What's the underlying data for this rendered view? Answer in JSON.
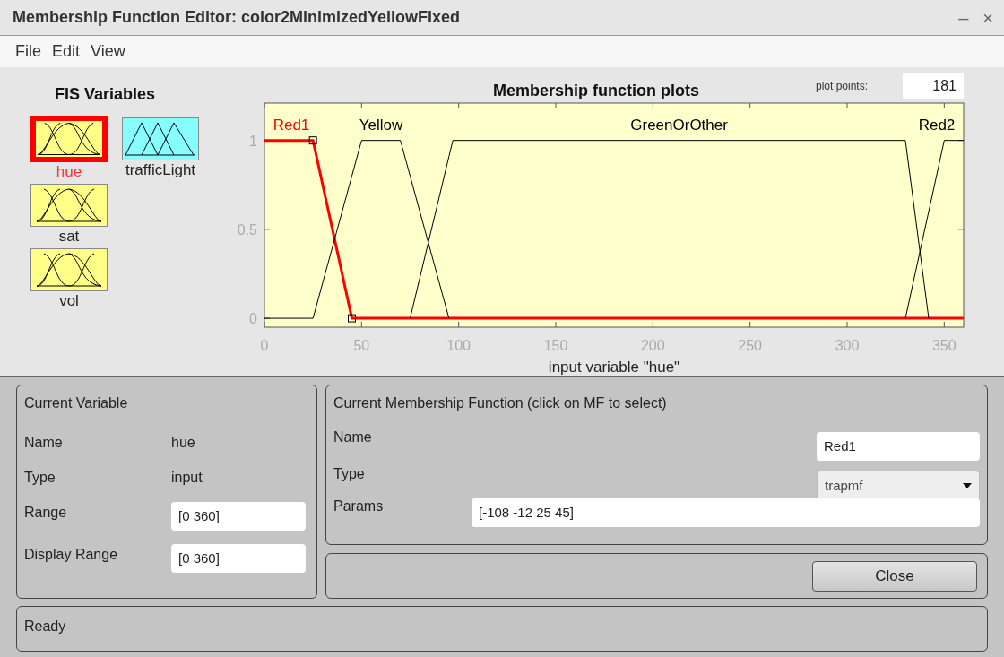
{
  "window": {
    "title": "Membership Function Editor: color2MinimizedYellowFixed",
    "controls": [
      "–",
      "×"
    ]
  },
  "menu": [
    "File",
    "Edit",
    "View"
  ],
  "fis_variables": {
    "title": "FIS Variables",
    "items": [
      {
        "name": "hue",
        "kind": "input",
        "selected": true
      },
      {
        "name": "trafficLight",
        "kind": "output",
        "selected": false
      },
      {
        "name": "sat",
        "kind": "input",
        "selected": false
      },
      {
        "name": "vol",
        "kind": "input",
        "selected": false
      }
    ]
  },
  "plot": {
    "plot_points_label": "plot points:",
    "plot_points": "181",
    "mfs": [
      {
        "selected": true
      },
      {
        "selected": false
      },
      {
        "selected": false
      },
      {
        "selected": false
      }
    ],
    "chart_data": {
      "type": "line",
      "title": "Membership function plots",
      "xlabel": "input variable \"hue\"",
      "x": [
        0,
        25,
        45,
        50,
        70,
        75,
        95,
        97,
        330,
        342,
        350,
        360
      ],
      "series": [
        {
          "name": "Red1",
          "color": "#ff0000",
          "values": [
            1,
            1,
            0,
            0,
            0,
            0,
            0,
            0,
            0,
            0,
            0,
            0
          ]
        },
        {
          "name": "Yellow",
          "color": "#000000",
          "values": [
            0,
            0,
            0.8,
            1,
            1,
            0.8,
            0,
            null,
            null,
            null,
            null,
            null
          ]
        },
        {
          "name": "GreenOrOther",
          "color": "#000000",
          "values": [
            null,
            null,
            null,
            null,
            null,
            0,
            0.91,
            1,
            1,
            0,
            null,
            null
          ]
        },
        {
          "name": "Red2",
          "color": "#000000",
          "values": [
            null,
            null,
            null,
            null,
            null,
            null,
            null,
            null,
            0,
            0.6,
            1,
            1
          ]
        }
      ],
      "xlim": [
        0,
        360
      ],
      "ylim": [
        -0.05,
        1.21
      ],
      "xticks": [
        0,
        50,
        100,
        150,
        200,
        250,
        300,
        350
      ],
      "yticks": [
        0,
        0.5,
        1
      ]
    }
  },
  "current_variable": {
    "title": "Current Variable",
    "name_label": "Name",
    "name": "hue",
    "type_label": "Type",
    "type": "input",
    "range_label": "Range",
    "range": "[0 360]",
    "display_range_label": "Display Range",
    "display_range": "[0 360]"
  },
  "current_mf": {
    "title": "Current Membership Function (click on MF to select)",
    "name_label": "Name",
    "name": "Red1",
    "type_label": "Type",
    "type": "trapmf",
    "params_label": "Params",
    "params": "[-108 -12 25 45]"
  },
  "close_button": "Close",
  "status": "Ready"
}
